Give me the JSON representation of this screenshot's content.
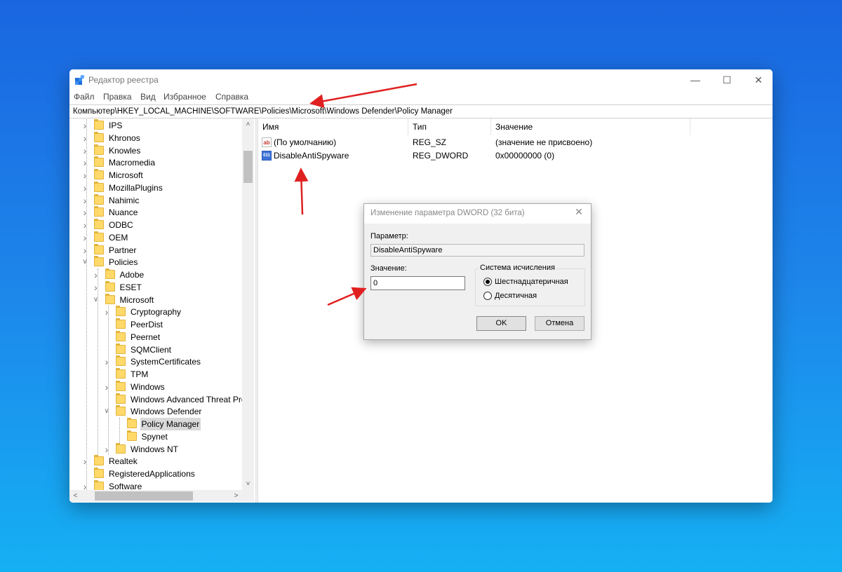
{
  "window": {
    "title": "Редактор реестра",
    "controls": {
      "minimize": "—",
      "maximize": "☐",
      "close": "✕"
    }
  },
  "menu": {
    "items": [
      "Файл",
      "Правка",
      "Вид",
      "Избранное",
      "Справка"
    ]
  },
  "address": "Компьютер\\HKEY_LOCAL_MACHINE\\SOFTWARE\\Policies\\Microsoft\\Windows Defender\\Policy Manager",
  "tree": {
    "items": [
      {
        "label": "IPS",
        "depth": 0,
        "state": "collapsed"
      },
      {
        "label": "Khronos",
        "depth": 0,
        "state": "collapsed"
      },
      {
        "label": "Knowles",
        "depth": 0,
        "state": "collapsed"
      },
      {
        "label": "Macromedia",
        "depth": 0,
        "state": "collapsed"
      },
      {
        "label": "Microsoft",
        "depth": 0,
        "state": "collapsed"
      },
      {
        "label": "MozillaPlugins",
        "depth": 0,
        "state": "collapsed"
      },
      {
        "label": "Nahimic",
        "depth": 0,
        "state": "collapsed"
      },
      {
        "label": "Nuance",
        "depth": 0,
        "state": "collapsed"
      },
      {
        "label": "ODBC",
        "depth": 0,
        "state": "collapsed"
      },
      {
        "label": "OEM",
        "depth": 0,
        "state": "collapsed"
      },
      {
        "label": "Partner",
        "depth": 0,
        "state": "collapsed"
      },
      {
        "label": "Policies",
        "depth": 0,
        "state": "expanded"
      },
      {
        "label": "Adobe",
        "depth": 1,
        "state": "collapsed"
      },
      {
        "label": "ESET",
        "depth": 1,
        "state": "collapsed"
      },
      {
        "label": "Microsoft",
        "depth": 1,
        "state": "expanded"
      },
      {
        "label": "Cryptography",
        "depth": 2,
        "state": "collapsed"
      },
      {
        "label": "PeerDist",
        "depth": 2,
        "state": "leaf"
      },
      {
        "label": "Peernet",
        "depth": 2,
        "state": "leaf"
      },
      {
        "label": "SQMClient",
        "depth": 2,
        "state": "leaf"
      },
      {
        "label": "SystemCertificates",
        "depth": 2,
        "state": "collapsed"
      },
      {
        "label": "TPM",
        "depth": 2,
        "state": "leaf"
      },
      {
        "label": "Windows",
        "depth": 2,
        "state": "collapsed"
      },
      {
        "label": "Windows Advanced Threat Pro",
        "depth": 2,
        "state": "leaf"
      },
      {
        "label": "Windows Defender",
        "depth": 2,
        "state": "expanded"
      },
      {
        "label": "Policy Manager",
        "depth": 3,
        "state": "leaf",
        "selected": true
      },
      {
        "label": "Spynet",
        "depth": 3,
        "state": "leaf"
      },
      {
        "label": "Windows NT",
        "depth": 2,
        "state": "collapsed"
      },
      {
        "label": "Realtek",
        "depth": 0,
        "state": "collapsed"
      },
      {
        "label": "RegisteredApplications",
        "depth": 0,
        "state": "leaf"
      },
      {
        "label": "Software",
        "depth": 0,
        "state": "collapsed"
      }
    ]
  },
  "scroll": {
    "up": "˄",
    "down": "˅",
    "left": "<",
    "right": ">"
  },
  "list": {
    "columns": [
      "Имя",
      "Тип",
      "Значение"
    ],
    "rows": [
      {
        "icon": "string-value-icon",
        "glyph": "ab",
        "name": "(По умолчанию)",
        "type": "REG_SZ",
        "value": "(значение не присвоено)"
      },
      {
        "icon": "dword-value-icon",
        "glyph": "011",
        "name": "DisableAntiSpyware",
        "type": "REG_DWORD",
        "value": "0x00000000 (0)"
      }
    ]
  },
  "dialog": {
    "title": "Изменение параметра DWORD (32 бита)",
    "close": "✕",
    "param_label": "Параметр:",
    "param_value": "DisableAntiSpyware",
    "value_label": "Значение:",
    "value": "0",
    "base_label": "Система исчисления",
    "options": [
      {
        "label": "Шестнадцатеричная",
        "checked": true
      },
      {
        "label": "Десятичная",
        "checked": false
      }
    ],
    "ok": "OK",
    "cancel": "Отмена"
  },
  "colors": {
    "background_top": "#1a66e0",
    "background_bottom": "#15b0f4",
    "folder": "#ffd96a",
    "annotation_arrow": "#e02020",
    "selection": "#d9d9d9"
  }
}
